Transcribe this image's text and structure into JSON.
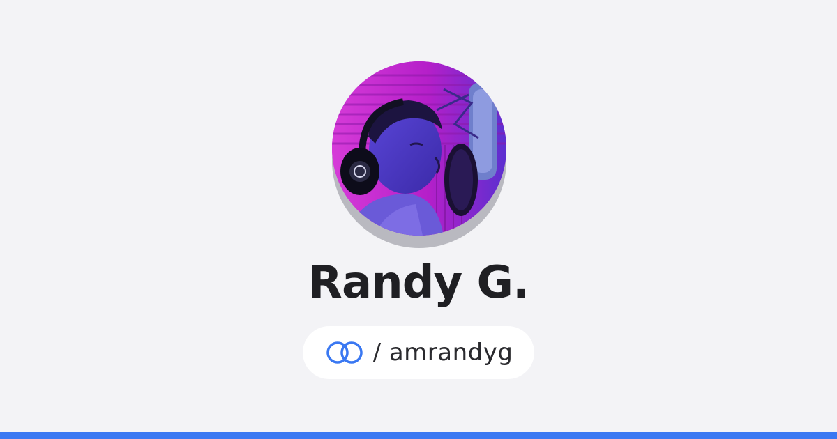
{
  "profile": {
    "name": "Randy G.",
    "handle": "/ amrandyg",
    "avatar_icon": "profile-photo"
  },
  "brand": {
    "logo_icon": "linked-rings-icon",
    "accent": "#3a78f2",
    "background": "#f3f3f6"
  }
}
